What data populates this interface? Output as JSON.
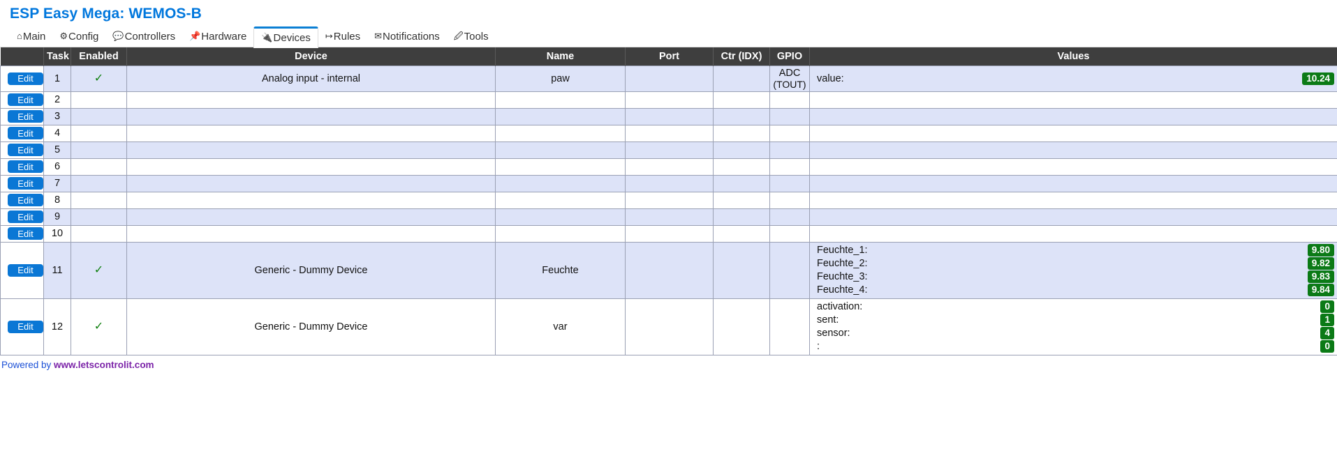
{
  "header": {
    "title": "ESP Easy Mega: WEMOS-B"
  },
  "tabs": [
    {
      "label": "Main",
      "icon": "home-icon",
      "glyph": "⌂",
      "active": false
    },
    {
      "label": "Config",
      "icon": "gear-icon",
      "glyph": "⚙",
      "active": false
    },
    {
      "label": "Controllers",
      "icon": "chat-icon",
      "glyph": "💬",
      "active": false
    },
    {
      "label": "Hardware",
      "icon": "pin-icon",
      "glyph": "📌",
      "active": false
    },
    {
      "label": "Devices",
      "icon": "plug-icon",
      "glyph": "🔌",
      "active": true
    },
    {
      "label": "Rules",
      "icon": "arrow-icon",
      "glyph": "↦",
      "active": false
    },
    {
      "label": "Notifications",
      "icon": "mail-icon",
      "glyph": "✉",
      "active": false
    },
    {
      "label": "Tools",
      "icon": "wrench-icon",
      "glyph": "🖉",
      "active": false
    }
  ],
  "table": {
    "columns": [
      "",
      "Task",
      "Enabled",
      "Device",
      "Name",
      "Port",
      "Ctr (IDX)",
      "GPIO",
      "Values"
    ],
    "edit_label": "Edit",
    "enabled_mark": "✓",
    "rows": [
      {
        "task": "1",
        "enabled": true,
        "device": "Analog input - internal",
        "name": "paw",
        "port": "",
        "ctr": "",
        "gpio": "ADC",
        "gpio2": "(TOUT)",
        "values": [
          {
            "label": "value:",
            "value": "10.24"
          }
        ]
      },
      {
        "task": "2",
        "enabled": false,
        "device": "",
        "name": "",
        "port": "",
        "ctr": "",
        "gpio": "",
        "gpio2": "",
        "values": []
      },
      {
        "task": "3",
        "enabled": false,
        "device": "",
        "name": "",
        "port": "",
        "ctr": "",
        "gpio": "",
        "gpio2": "",
        "values": []
      },
      {
        "task": "4",
        "enabled": false,
        "device": "",
        "name": "",
        "port": "",
        "ctr": "",
        "gpio": "",
        "gpio2": "",
        "values": []
      },
      {
        "task": "5",
        "enabled": false,
        "device": "",
        "name": "",
        "port": "",
        "ctr": "",
        "gpio": "",
        "gpio2": "",
        "values": []
      },
      {
        "task": "6",
        "enabled": false,
        "device": "",
        "name": "",
        "port": "",
        "ctr": "",
        "gpio": "",
        "gpio2": "",
        "values": []
      },
      {
        "task": "7",
        "enabled": false,
        "device": "",
        "name": "",
        "port": "",
        "ctr": "",
        "gpio": "",
        "gpio2": "",
        "values": []
      },
      {
        "task": "8",
        "enabled": false,
        "device": "",
        "name": "",
        "port": "",
        "ctr": "",
        "gpio": "",
        "gpio2": "",
        "values": []
      },
      {
        "task": "9",
        "enabled": false,
        "device": "",
        "name": "",
        "port": "",
        "ctr": "",
        "gpio": "",
        "gpio2": "",
        "values": []
      },
      {
        "task": "10",
        "enabled": false,
        "device": "",
        "name": "",
        "port": "",
        "ctr": "",
        "gpio": "",
        "gpio2": "",
        "values": []
      },
      {
        "task": "11",
        "enabled": true,
        "device": "Generic - Dummy Device",
        "name": "Feuchte",
        "port": "",
        "ctr": "",
        "gpio": "",
        "gpio2": "",
        "values": [
          {
            "label": "Feuchte_1:",
            "value": "9.80"
          },
          {
            "label": "Feuchte_2:",
            "value": "9.82"
          },
          {
            "label": "Feuchte_3:",
            "value": "9.83"
          },
          {
            "label": "Feuchte_4:",
            "value": "9.84"
          }
        ]
      },
      {
        "task": "12",
        "enabled": true,
        "device": "Generic - Dummy Device",
        "name": "var",
        "port": "",
        "ctr": "",
        "gpio": "",
        "gpio2": "",
        "values": [
          {
            "label": "activation:",
            "value": "0"
          },
          {
            "label": "sent:",
            "value": "1"
          },
          {
            "label": "sensor:",
            "value": "4"
          },
          {
            "label": ":",
            "value": "0"
          }
        ]
      }
    ]
  },
  "footer": {
    "prefix": "Powered by ",
    "link": "www.letscontrolit.com"
  },
  "colors": {
    "accent": "#0b7fd4",
    "title": "#0077dd",
    "header_bg": "#3e3e3e",
    "alt_row": "#dde3f8",
    "badge": "#0b7a16",
    "button": "#0a77d5",
    "check": "#108010"
  }
}
